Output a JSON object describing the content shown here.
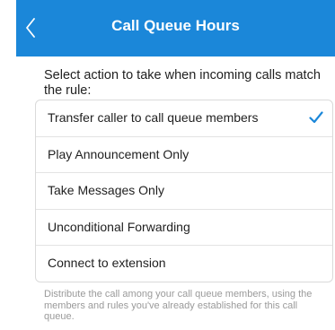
{
  "header": {
    "title": "Call Queue Hours",
    "back_icon": "chevron-left-icon"
  },
  "prompt": "Select action to take when incoming calls match the rule:",
  "options": [
    {
      "label": "Transfer caller to call queue members",
      "selected": true
    },
    {
      "label": "Play Announcement Only",
      "selected": false
    },
    {
      "label": "Take Messages Only",
      "selected": false
    },
    {
      "label": "Unconditional Forwarding",
      "selected": false
    },
    {
      "label": "Connect to extension",
      "selected": false
    }
  ],
  "hint": "Distribute the call among your call queue members, using the members and rules you've already established for this call queue.",
  "colors": {
    "header_bg": "#1b87d9",
    "check": "#1b87d9"
  }
}
